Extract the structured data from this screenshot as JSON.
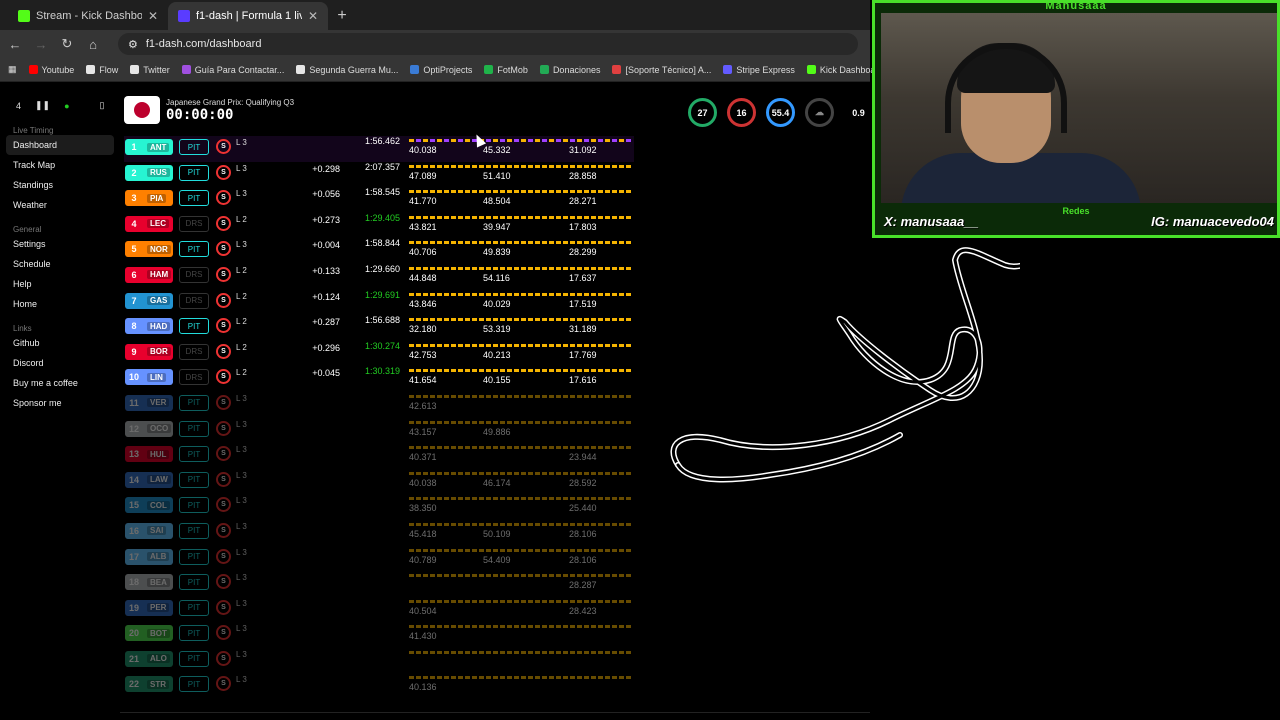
{
  "browser": {
    "tabs": [
      {
        "title": "Stream - Kick Dashboard",
        "icon": "kick-icon",
        "color": "#53fc18",
        "active": false
      },
      {
        "title": "f1-dash | Formula 1 live timing",
        "icon": "f1-dash-icon",
        "color": "#5a3cff",
        "active": true
      }
    ],
    "url": "f1-dash.com/dashboard",
    "bookmarks": [
      {
        "label": "Youtube",
        "color": "#ff0000"
      },
      {
        "label": "Flow",
        "color": "#e6e6e6"
      },
      {
        "label": "Twitter",
        "color": "#e6e6e6"
      },
      {
        "label": "Guía Para Contactar...",
        "color": "#a050e0"
      },
      {
        "label": "Segunda Guerra Mu...",
        "color": "#e6e6e6"
      },
      {
        "label": "OptiProjects",
        "color": "#3a7bd5"
      },
      {
        "label": "FotMob",
        "color": "#1fb34a"
      },
      {
        "label": "Donaciones",
        "color": "#22aa55"
      },
      {
        "label": "[Soporte Técnico] A...",
        "color": "#e04040"
      },
      {
        "label": "Stripe Express",
        "color": "#635bff"
      },
      {
        "label": "Kick Dashboard",
        "color": "#53fc18"
      }
    ]
  },
  "sidebar": {
    "delay": "4",
    "sections": [
      {
        "title": "Live Timing",
        "items": [
          "Dashboard",
          "Track Map",
          "Standings",
          "Weather"
        ]
      },
      {
        "title": "General",
        "items": [
          "Settings",
          "Schedule",
          "Help",
          "Home"
        ]
      },
      {
        "title": "Links",
        "items": [
          "Github",
          "Discord",
          "Buy me a coffee",
          "Sponsor me"
        ]
      }
    ]
  },
  "session": {
    "title": "Japanese Grand Prix: Qualifying Q3",
    "clock": "00:00:00",
    "weather": [
      "27",
      "16",
      "55.4",
      "",
      "0.9"
    ]
  },
  "drivers": [
    {
      "pos": "1",
      "tla": "ANT",
      "color": "#27f4d2",
      "pit": "PIT",
      "lap": "L 3",
      "gap": "",
      "time": "1:56.462",
      "green": false,
      "s1": "40.038",
      "s2": "45.332",
      "s3": "31.092",
      "out": false
    },
    {
      "pos": "2",
      "tla": "RUS",
      "color": "#27f4d2",
      "pit": "PIT",
      "lap": "L 3",
      "gap": "+0.298",
      "time": "2:07.357",
      "green": false,
      "s1": "47.089",
      "s2": "51.410",
      "s3": "28.858",
      "out": false
    },
    {
      "pos": "3",
      "tla": "PIA",
      "color": "#ff8000",
      "pit": "PIT",
      "lap": "L 3",
      "gap": "+0.056",
      "time": "1:58.545",
      "green": false,
      "s1": "41.770",
      "s2": "48.504",
      "s3": "28.271",
      "out": false
    },
    {
      "pos": "4",
      "tla": "LEC",
      "color": "#e8002d",
      "pit": "DRS",
      "lap": "L 2",
      "gap": "+0.273",
      "time": "1:29.405",
      "green": true,
      "s1": "43.821",
      "s2": "39.947",
      "s3": "17.803",
      "out": false
    },
    {
      "pos": "5",
      "tla": "NOR",
      "color": "#ff8000",
      "pit": "PIT",
      "lap": "L 3",
      "gap": "+0.004",
      "time": "1:58.844",
      "green": false,
      "s1": "40.706",
      "s2": "49.839",
      "s3": "28.299",
      "out": false
    },
    {
      "pos": "6",
      "tla": "HAM",
      "color": "#e8002d",
      "pit": "DRS",
      "lap": "L 2",
      "gap": "+0.133",
      "time": "1:29.660",
      "green": false,
      "s1": "44.848",
      "s2": "54.116",
      "s3": "17.637",
      "out": false
    },
    {
      "pos": "7",
      "tla": "GAS",
      "color": "#2293d1",
      "pit": "DRS",
      "lap": "L 2",
      "gap": "+0.124",
      "time": "1:29.691",
      "green": true,
      "s1": "43.846",
      "s2": "40.029",
      "s3": "17.519",
      "out": false
    },
    {
      "pos": "8",
      "tla": "HAD",
      "color": "#6692ff",
      "pit": "PIT",
      "lap": "L 2",
      "gap": "+0.287",
      "time": "1:56.688",
      "green": false,
      "s1": "32.180",
      "s2": "53.319",
      "s3": "31.189",
      "out": false
    },
    {
      "pos": "9",
      "tla": "BOR",
      "color": "#e8002d",
      "pit": "DRS",
      "lap": "L 2",
      "gap": "+0.296",
      "time": "1:30.274",
      "green": true,
      "s1": "42.753",
      "s2": "40.213",
      "s3": "17.769",
      "out": false
    },
    {
      "pos": "10",
      "tla": "LIN",
      "color": "#6692ff",
      "pit": "DRS",
      "lap": "L 2",
      "gap": "+0.045",
      "time": "1:30.319",
      "green": true,
      "s1": "41.654",
      "s2": "40.155",
      "s3": "17.616",
      "out": false
    },
    {
      "pos": "11",
      "tla": "VER",
      "color": "#3671c6",
      "pit": "PIT",
      "lap": "L 3",
      "gap": "",
      "time": "",
      "green": false,
      "s1": "42.613",
      "s2": "",
      "s3": "",
      "out": true
    },
    {
      "pos": "12",
      "tla": "OCO",
      "color": "#b6babd",
      "pit": "PIT",
      "lap": "L 3",
      "gap": "",
      "time": "",
      "green": false,
      "s1": "43.157",
      "s2": "49.886",
      "s3": "",
      "out": true
    },
    {
      "pos": "13",
      "tla": "HUL",
      "color": "#e8002d",
      "pit": "PIT",
      "lap": "L 3",
      "gap": "",
      "time": "",
      "green": false,
      "s1": "40.371",
      "s2": "",
      "s3": "23.944",
      "out": true
    },
    {
      "pos": "14",
      "tla": "LAW",
      "color": "#3671c6",
      "pit": "PIT",
      "lap": "L 3",
      "gap": "",
      "time": "",
      "green": false,
      "s1": "40.038",
      "s2": "46.174",
      "s3": "28.592",
      "out": true
    },
    {
      "pos": "15",
      "tla": "COL",
      "color": "#2293d1",
      "pit": "PIT",
      "lap": "L 3",
      "gap": "",
      "time": "",
      "green": false,
      "s1": "38.350",
      "s2": "",
      "s3": "25.440",
      "out": true
    },
    {
      "pos": "16",
      "tla": "SAI",
      "color": "#64c4ff",
      "pit": "PIT",
      "lap": "L 3",
      "gap": "",
      "time": "",
      "green": false,
      "s1": "45.418",
      "s2": "50.109",
      "s3": "28.106",
      "out": true
    },
    {
      "pos": "17",
      "tla": "ALB",
      "color": "#64c4ff",
      "pit": "PIT",
      "lap": "L 3",
      "gap": "",
      "time": "",
      "green": false,
      "s1": "40.789",
      "s2": "54.409",
      "s3": "28.106",
      "out": true
    },
    {
      "pos": "18",
      "tla": "BEA",
      "color": "#b6babd",
      "pit": "PIT",
      "lap": "L 3",
      "gap": "",
      "time": "",
      "green": false,
      "s1": "",
      "s2": "",
      "s3": "28.287",
      "out": true
    },
    {
      "pos": "19",
      "tla": "PER",
      "color": "#3671c6",
      "pit": "PIT",
      "lap": "L 3",
      "gap": "",
      "time": "",
      "green": false,
      "s1": "40.504",
      "s2": "",
      "s3": "28.423",
      "out": true
    },
    {
      "pos": "20",
      "tla": "BOT",
      "color": "#52e252",
      "pit": "PIT",
      "lap": "L 3",
      "gap": "",
      "time": "",
      "green": false,
      "s1": "41.430",
      "s2": "",
      "s3": "",
      "out": true
    },
    {
      "pos": "21",
      "tla": "ALO",
      "color": "#229971",
      "pit": "PIT",
      "lap": "L 3",
      "gap": "",
      "time": "",
      "green": false,
      "s1": "",
      "s2": "",
      "s3": "",
      "out": true
    },
    {
      "pos": "22",
      "tla": "STR",
      "color": "#229971",
      "pit": "PIT",
      "lap": "L 3",
      "gap": "",
      "time": "",
      "green": false,
      "s1": "40.136",
      "s2": "",
      "s3": "",
      "out": true
    }
  ],
  "webcam": {
    "top_label": "Manusaaa",
    "bottom_label": "Redes",
    "social_x": "X: manusaaa__",
    "social_ig": "IG: manuacevedo04"
  }
}
